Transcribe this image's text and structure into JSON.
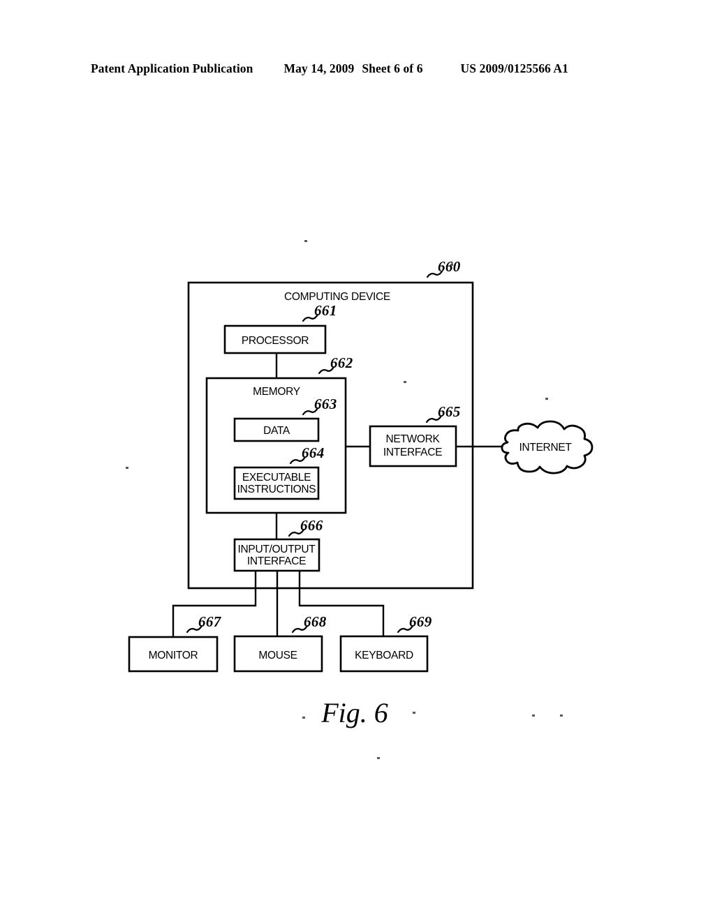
{
  "header": {
    "publication": "Patent Application Publication",
    "date": "May 14, 2009",
    "sheet": "Sheet 6 of 6",
    "patent_number": "US 2009/0125566 A1"
  },
  "figure": {
    "caption": "Fig. 6",
    "outer": {
      "label": "COMPUTING DEVICE",
      "ref": "660"
    },
    "blocks": [
      {
        "id": "processor",
        "label_line1": "PROCESSOR",
        "label_line2": "",
        "ref": "661"
      },
      {
        "id": "memory",
        "label_line1": "MEMORY",
        "label_line2": "",
        "ref": "662"
      },
      {
        "id": "data",
        "label_line1": "DATA",
        "label_line2": "",
        "ref": "663"
      },
      {
        "id": "executable",
        "label_line1": "EXECUTABLE",
        "label_line2": "INSTRUCTIONS",
        "ref": "664"
      },
      {
        "id": "network",
        "label_line1": "NETWORK",
        "label_line2": "INTERFACE",
        "ref": "665"
      },
      {
        "id": "io",
        "label_line1": "INPUT/OUTPUT",
        "label_line2": "INTERFACE",
        "ref": "666"
      },
      {
        "id": "monitor",
        "label_line1": "MONITOR",
        "label_line2": "",
        "ref": "667"
      },
      {
        "id": "mouse",
        "label_line1": "MOUSE",
        "label_line2": "",
        "ref": "668"
      },
      {
        "id": "keyboard",
        "label_line1": "KEYBOARD",
        "label_line2": "",
        "ref": "669"
      }
    ],
    "cloud": {
      "label": "INTERNET"
    }
  }
}
